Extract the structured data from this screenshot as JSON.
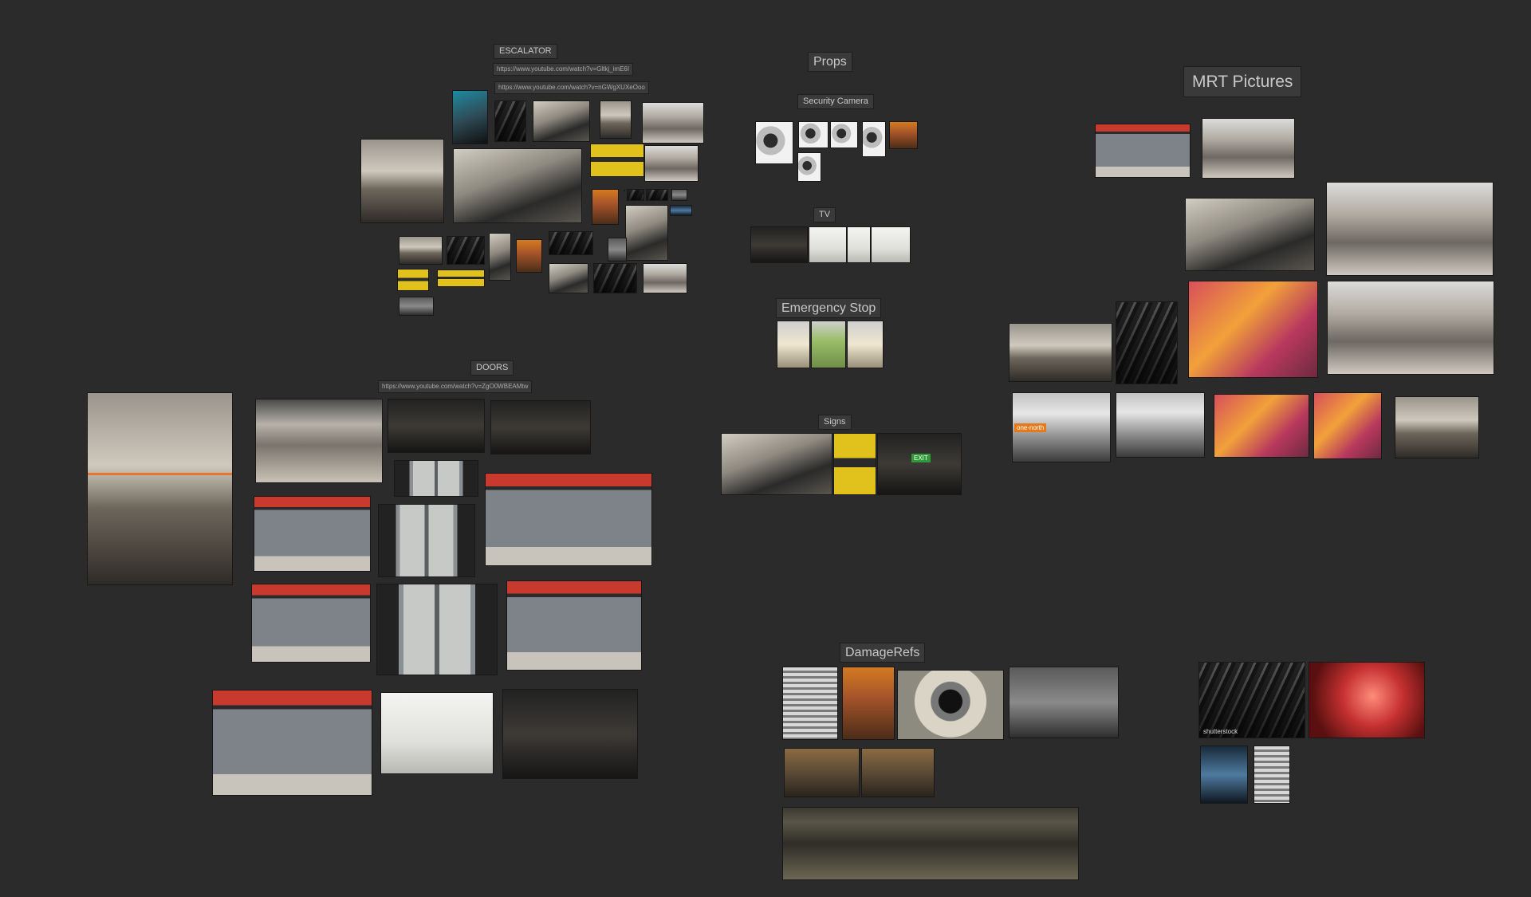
{
  "groups": {
    "escalator": {
      "title": "ESCALATOR",
      "urls": [
        "https://www.youtube.com/watch?v=Gltkj_imE6I",
        "https://www.youtube.com/watch?v=nGWgXUXeOoo"
      ]
    },
    "doors": {
      "title": "DOORS",
      "urls": [
        "https://www.youtube.com/watch?v=ZgO0WBEAMtw"
      ]
    },
    "props": {
      "title": "Props"
    },
    "security_camera": {
      "title": "Security Camera"
    },
    "tv": {
      "title": "TV"
    },
    "emergency_stop": {
      "title": "Emergency Stop"
    },
    "signs": {
      "title": "Signs"
    },
    "damage_refs": {
      "title": "DamageRefs"
    },
    "mrt_pictures": {
      "title": "MRT Pictures"
    }
  },
  "image_text": {
    "one_north": "one-north",
    "shutterstock": "shutterstock",
    "exit": "EXIT"
  }
}
